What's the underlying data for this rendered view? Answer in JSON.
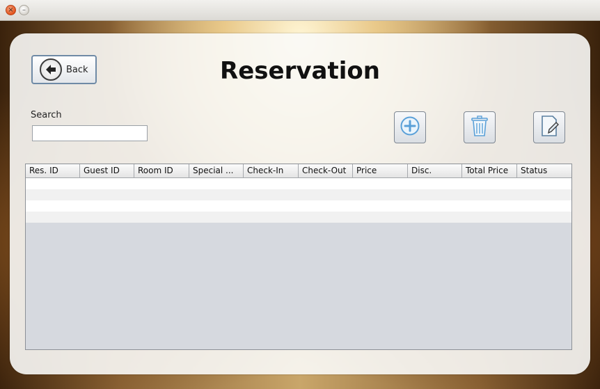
{
  "window": {
    "close_glyph": "×",
    "minimize_glyph": "–"
  },
  "header": {
    "back_label": "Back",
    "title": "Reservation"
  },
  "search": {
    "label": "Search",
    "value": ""
  },
  "toolbar": {
    "add_icon": "plus-circle-icon",
    "delete_icon": "trash-icon",
    "edit_icon": "edit-document-icon"
  },
  "table": {
    "columns": [
      "Res. ID",
      "Guest ID",
      "Room ID",
      "Special ...",
      "Check-In",
      "Check-Out",
      "Price",
      "Disc.",
      "Total Price",
      "Status"
    ],
    "rows": []
  },
  "colors": {
    "accent": "#6f8aa6",
    "icon_blue": "#5aa0d8"
  }
}
